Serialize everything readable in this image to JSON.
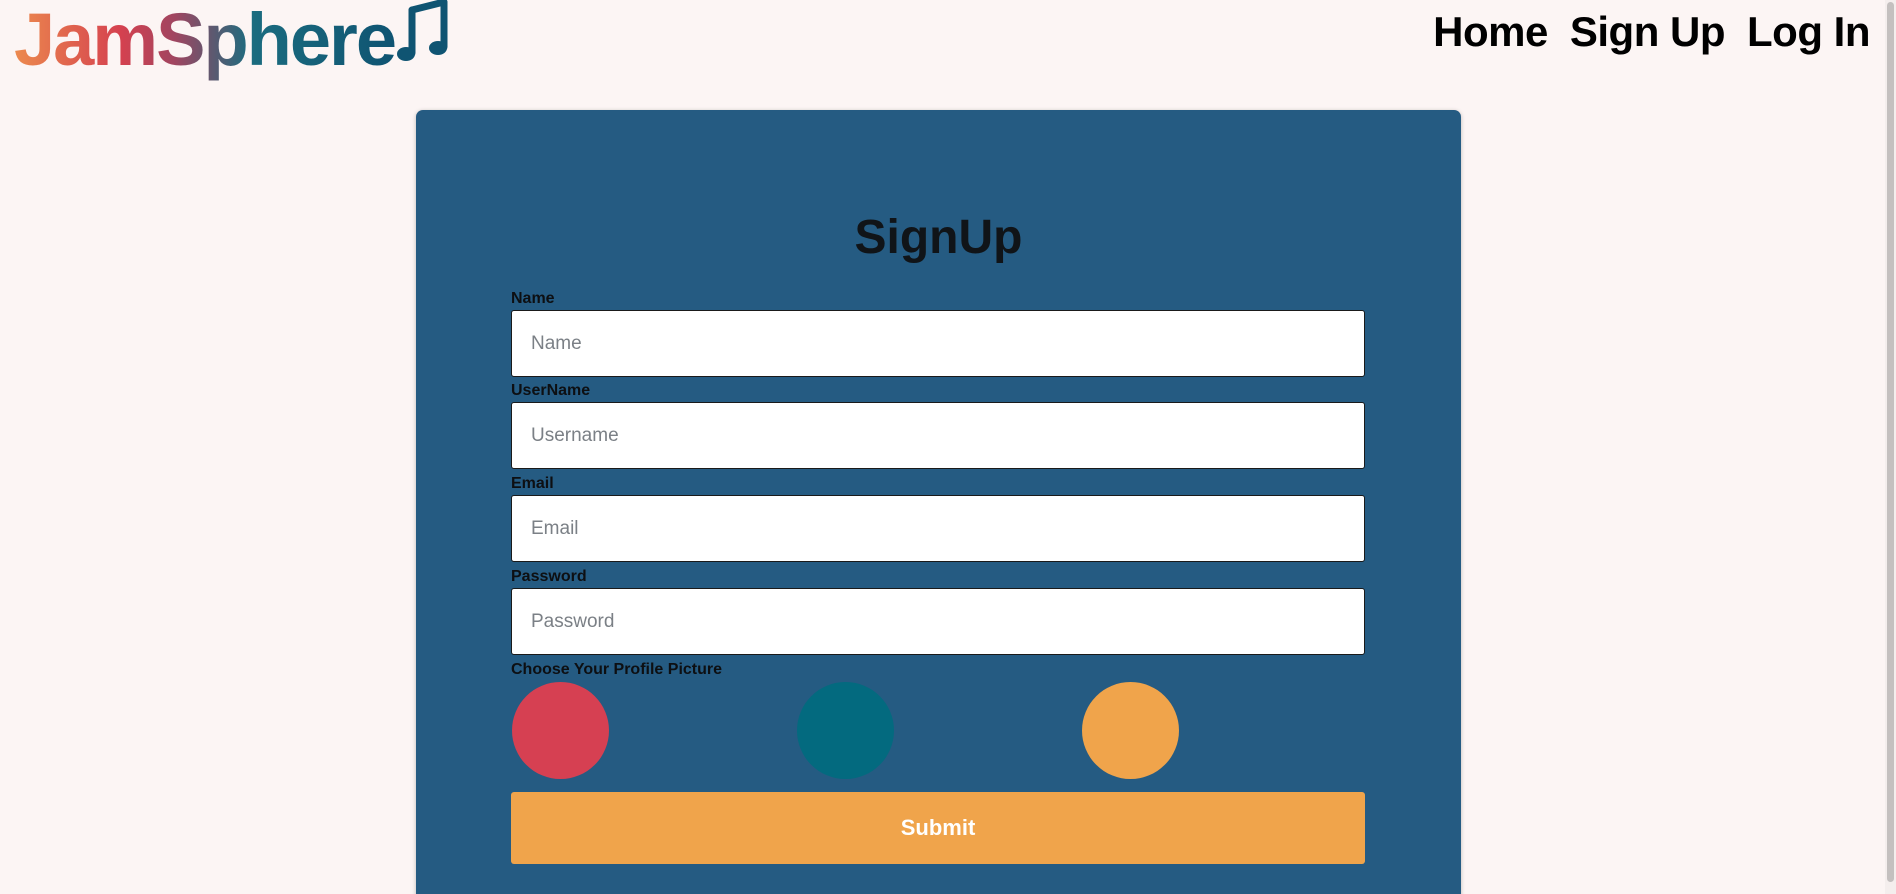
{
  "header": {
    "logo_text": "JamSphere",
    "logo_icon": "music-note-icon",
    "nav": [
      {
        "label": "Home"
      },
      {
        "label": "Sign Up"
      },
      {
        "label": "Log In"
      }
    ]
  },
  "form": {
    "title": "SignUp",
    "fields": [
      {
        "label": "Name",
        "placeholder": "Name",
        "value": ""
      },
      {
        "label": "UserName",
        "placeholder": "Username",
        "value": ""
      },
      {
        "label": "Email",
        "placeholder": "Email",
        "value": ""
      },
      {
        "label": "Password",
        "placeholder": "Password",
        "value": ""
      }
    ],
    "profile_label": "Choose Your Profile Picture",
    "avatars": [
      {
        "color": "#d64052"
      },
      {
        "color": "#036a7f"
      },
      {
        "color": "#f0a44b"
      }
    ],
    "submit_label": "Submit"
  },
  "colors": {
    "background": "#fcf5f4",
    "card": "#255b82",
    "accent": "#f0a44b",
    "logo_gradient_start": "#ec8a4e",
    "logo_gradient_end": "#0f5472"
  }
}
